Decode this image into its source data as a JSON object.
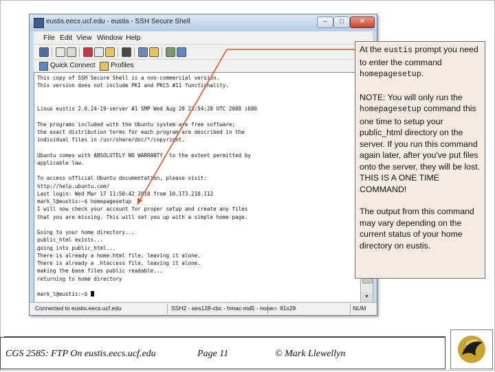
{
  "window": {
    "title": "eustis.eecs.ucf.edu - eustis - SSH Secure Shell",
    "controls": {
      "minimize": "–",
      "maximize": "□",
      "close": "✕"
    }
  },
  "menu": [
    "File",
    "Edit",
    "View",
    "Window",
    "Help"
  ],
  "profile_bar": {
    "quick_connect": "Quick Connect",
    "profiles": "Profiles"
  },
  "terminal": {
    "lines": [
      "This copy of SSH Secure Shell is a non-commercial version.",
      "This version does not include PKI and PKCS #11 functionality.",
      "",
      "",
      "Linux eustis 2.6.24-19-server #1 SMP Wed Aug 20 23:54:28 UTC 2008 i686",
      "",
      "The programs included with the Ubuntu system are free software;",
      "the exact distribution terms for each program are described in the",
      "individual files in /usr/share/doc/*/copyright.",
      "",
      "Ubuntu comes with ABSOLUTELY NO WARRANTY, to the extent permitted by",
      "applicable law.",
      "",
      "To access official Ubuntu documentation, please visit:",
      "http://help.ubuntu.com/",
      "Last login: Wed Mar 17 11:50:42 2010 from 10.173.210.112",
      "mark_l@eustis:~$ homepagesetup",
      "I will now check your account for proper setup and create any files",
      "that you are missing. This will set you up with a simple home page.",
      "",
      "Going to your home directory...",
      "public_html exists...",
      "going into public_html...",
      "There is already a home.html file, leaving it alone.",
      "There is already a .htaccess file, leaving it alone.",
      "making the base files public readable...",
      "returning to home directory",
      "",
      "mark_l@eustis:~$ "
    ]
  },
  "status_bar": {
    "connection": "Connected to eustis.eecs.ucf.edu",
    "protocol": "SSH2 - aes128-cbc - hmac-md5 - none",
    "size": "91x29",
    "num": "NUM"
  },
  "callout": {
    "p1_pre": "At the ",
    "p1_cmd": "eustis",
    "p1_mid": " prompt you need to enter the command ",
    "p1_cmd2": "homepagesetup",
    "p1_end": ".",
    "p2_pre": "NOTE:  You will only run the ",
    "p2_cmd": "homepagesetup",
    "p2_end": " command this one time to setup your public_html directory on the server.  If you run this command again later, after you've put files onto the server, they will be lost.  THIS IS A ONE TIME COMMAND!",
    "p3": "The output from this command may vary depending on the current status of your home directory on eustis."
  },
  "footer": {
    "course": "CGS 2585:  FTP On eustis.eecs.ucf.edu",
    "page": "Page 11",
    "author": "© Mark Llewellyn"
  },
  "colors": {
    "arrow": "#d9542a",
    "callout_bg": "#f6ebe3",
    "window_frame": "#c9d9ec"
  },
  "icons": [
    "save-icon",
    "print-icon",
    "find-icon",
    "copy-icon",
    "paste-icon",
    "settings-icon",
    "help-icon",
    "quick-connect-icon",
    "profiles-folder-icon",
    "ucf-pegasus-logo"
  ]
}
